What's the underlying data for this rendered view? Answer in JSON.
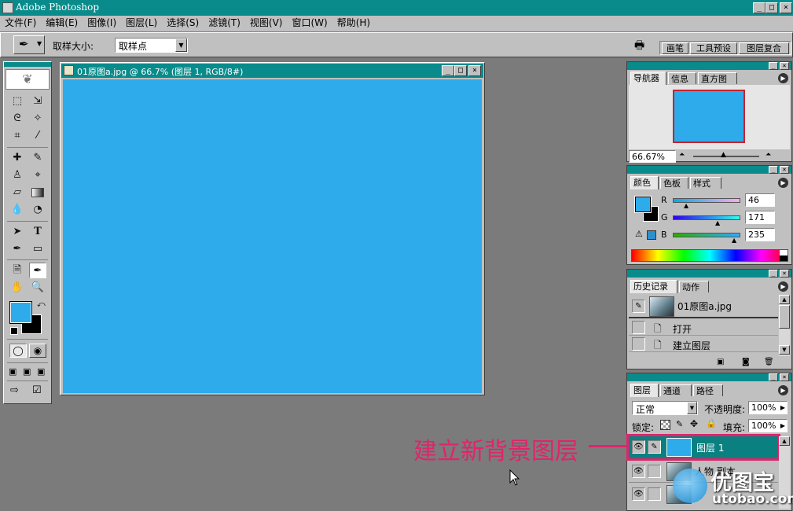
{
  "app": {
    "title": "Adobe Photoshop"
  },
  "menu": [
    {
      "label": "文件(F)"
    },
    {
      "label": "编辑(E)"
    },
    {
      "label": "图像(I)"
    },
    {
      "label": "图层(L)"
    },
    {
      "label": "选择(S)"
    },
    {
      "label": "滤镜(T)"
    },
    {
      "label": "视图(V)"
    },
    {
      "label": "窗口(W)"
    },
    {
      "label": "帮助(H)"
    }
  ],
  "options": {
    "sample_label": "取样大小:",
    "sample_value": "取样点"
  },
  "palette_well": {
    "tabs": [
      "画笔",
      "工具预设",
      "图层复合"
    ]
  },
  "document": {
    "title": "01原图a.jpg @ 66.7% (图层 1, RGB/8#)",
    "fill_color": "#2eabeb"
  },
  "navigator": {
    "tabs": [
      "导航器",
      "信息",
      "直方图"
    ],
    "zoom": "66.67%"
  },
  "color_panel": {
    "tabs": [
      "颜色",
      "色板",
      "样式"
    ],
    "r_label": "R",
    "g_label": "G",
    "b_label": "B",
    "r": "46",
    "g": "171",
    "b": "235",
    "foreground": "#2eabeb",
    "background": "#000000"
  },
  "history": {
    "tabs": [
      "历史记录",
      "动作"
    ],
    "snapshot": "01原图a.jpg",
    "steps": [
      "打开",
      "建立图层"
    ]
  },
  "layers": {
    "tabs": [
      "图层",
      "通道",
      "路径"
    ],
    "blend_mode": "正常",
    "opacity_label": "不透明度:",
    "opacity": "100%",
    "lock_label": "锁定:",
    "fill_label": "填充:",
    "fill": "100%",
    "items": [
      {
        "name": "图层 1",
        "selected": true
      },
      {
        "name": "人物 副本",
        "selected": false
      },
      {
        "name": "",
        "selected": false
      }
    ]
  },
  "annotation": {
    "text": "建立新背景图层",
    "color": "#e0246a"
  },
  "watermark": {
    "brand": "优图宝",
    "url": "utobao.com"
  }
}
